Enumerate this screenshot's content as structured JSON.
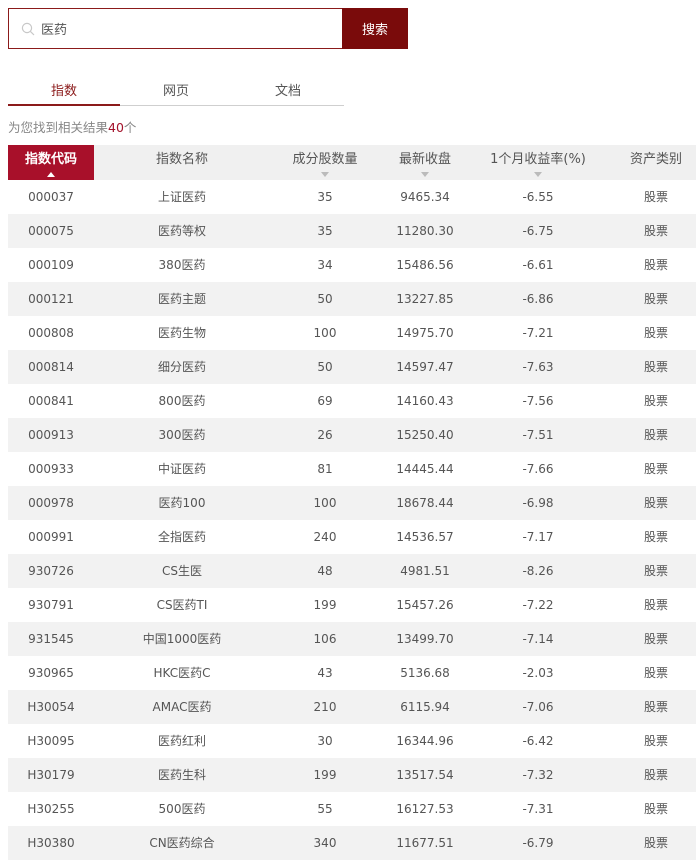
{
  "search": {
    "value": "医药",
    "button_label": "搜索"
  },
  "tabs": [
    {
      "label": "指数",
      "active": true
    },
    {
      "label": "网页",
      "active": false
    },
    {
      "label": "文档",
      "active": false
    }
  ],
  "result": {
    "prefix": "为您找到相关结果",
    "count": "40",
    "suffix": "个"
  },
  "table": {
    "headers": [
      "指数代码",
      "指数名称",
      "成分股数量",
      "最新收盘",
      "1个月收益率(%)",
      "资产类别"
    ],
    "rows": [
      [
        "000037",
        "上证医药",
        "35",
        "9465.34",
        "-6.55",
        "股票"
      ],
      [
        "000075",
        "医药等权",
        "35",
        "11280.30",
        "-6.75",
        "股票"
      ],
      [
        "000109",
        "380医药",
        "34",
        "15486.56",
        "-6.61",
        "股票"
      ],
      [
        "000121",
        "医药主题",
        "50",
        "13227.85",
        "-6.86",
        "股票"
      ],
      [
        "000808",
        "医药生物",
        "100",
        "14975.70",
        "-7.21",
        "股票"
      ],
      [
        "000814",
        "细分医药",
        "50",
        "14597.47",
        "-7.63",
        "股票"
      ],
      [
        "000841",
        "800医药",
        "69",
        "14160.43",
        "-7.56",
        "股票"
      ],
      [
        "000913",
        "300医药",
        "26",
        "15250.40",
        "-7.51",
        "股票"
      ],
      [
        "000933",
        "中证医药",
        "81",
        "14445.44",
        "-7.66",
        "股票"
      ],
      [
        "000978",
        "医药100",
        "100",
        "18678.44",
        "-6.98",
        "股票"
      ],
      [
        "000991",
        "全指医药",
        "240",
        "14536.57",
        "-7.17",
        "股票"
      ],
      [
        "930726",
        "CS生医",
        "48",
        "4981.51",
        "-8.26",
        "股票"
      ],
      [
        "930791",
        "CS医药TI",
        "199",
        "15457.26",
        "-7.22",
        "股票"
      ],
      [
        "931545",
        "中国1000医药",
        "106",
        "13499.70",
        "-7.14",
        "股票"
      ],
      [
        "930965",
        "HKC医药C",
        "43",
        "5136.68",
        "-2.03",
        "股票"
      ],
      [
        "H30054",
        "AMAC医药",
        "210",
        "6115.94",
        "-7.06",
        "股票"
      ],
      [
        "H30095",
        "医药红利",
        "30",
        "16344.96",
        "-6.42",
        "股票"
      ],
      [
        "H30179",
        "医药生科",
        "199",
        "13517.54",
        "-7.32",
        "股票"
      ],
      [
        "H30255",
        "500医药",
        "55",
        "16127.53",
        "-7.31",
        "股票"
      ],
      [
        "H30380",
        "CN医药综合",
        "340",
        "11677.51",
        "-6.79",
        "股票"
      ]
    ]
  }
}
